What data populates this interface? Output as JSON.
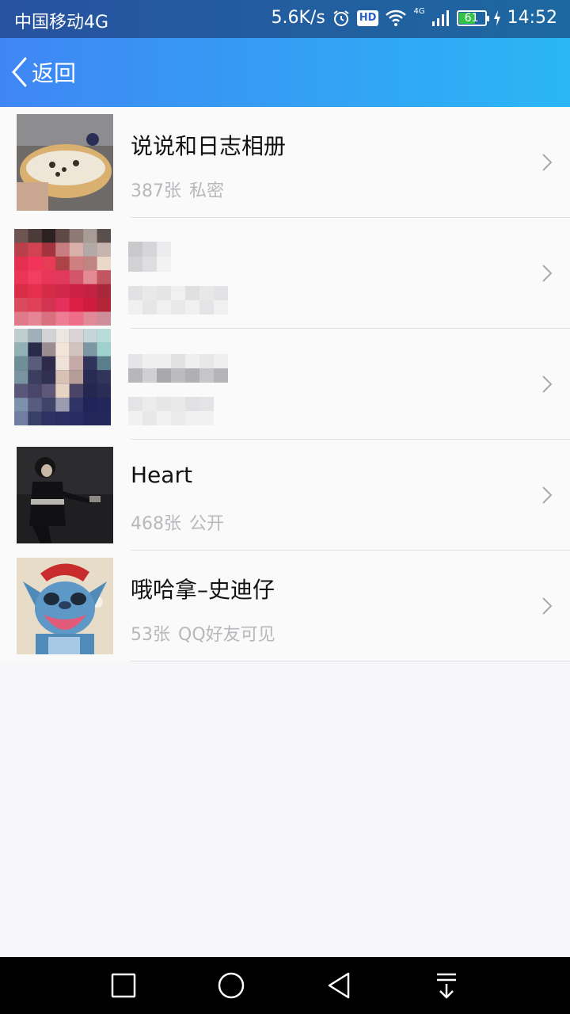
{
  "status_bar": {
    "carrier": "中国移动4G",
    "speed": "5.6K/s",
    "hd_label": "HD",
    "network_label": "4G",
    "battery": "61",
    "time": "14:52",
    "icons": [
      "alarm-icon",
      "hd-icon",
      "wifi-icon",
      "signal-icon",
      "battery-icon",
      "charging-icon"
    ]
  },
  "header": {
    "back_label": "返回",
    "back_icon": "chevron-left-icon"
  },
  "albums": [
    {
      "title": "说说和日志相册",
      "count": "387张",
      "privacy": "私密"
    },
    {
      "title": "",
      "count": "",
      "privacy": ""
    },
    {
      "title": "",
      "count": "",
      "privacy": ""
    },
    {
      "title": "Heart",
      "count": "468张",
      "privacy": "公开"
    },
    {
      "title": "哦哈拿–史迪仔",
      "count": "53张",
      "privacy": "QQ好友可见"
    }
  ],
  "nav_bar": {
    "icons": [
      "square-icon",
      "circle-icon",
      "triangle-back-icon",
      "download-icon"
    ]
  },
  "colors": {
    "header_start": "#3f86f4",
    "header_end": "#2ab6f5",
    "background": "#f7f7f9",
    "subtitle": "#b8b8bc"
  }
}
